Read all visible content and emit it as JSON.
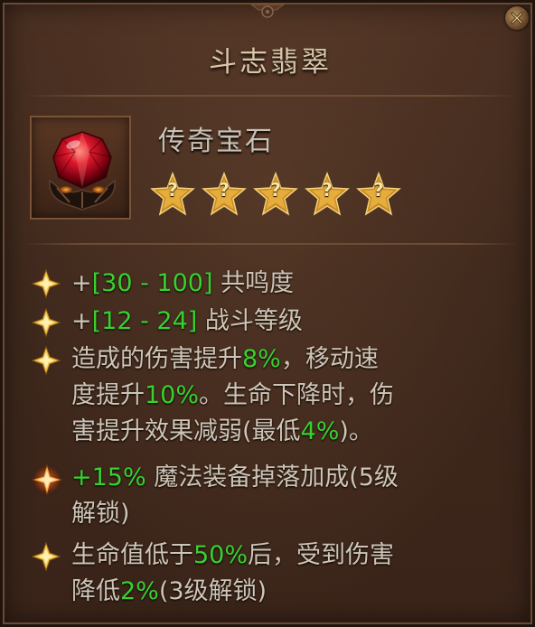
{
  "item": {
    "title": "斗志翡翠",
    "type_label": "传奇宝石",
    "rank_stars": [
      "?",
      "?",
      "?",
      "?",
      "?"
    ]
  },
  "attributes": [
    {
      "plus": "+",
      "value": "[30 - 100]",
      "label": " 共鸣度"
    },
    {
      "plus": "+",
      "value": "[12 - 24]",
      "label": " 战斗等级"
    },
    {
      "line1_a": "造成的伤害提升",
      "line1_v": "8%",
      "line1_b": "，移动速",
      "line2_a": "度提升",
      "line2_v": "10%",
      "line2_b": "。生命下降时，伤",
      "line3_a": "害提升效果减弱(最低",
      "line3_v": "4%",
      "line3_b": ")。"
    },
    {
      "line1_v": "+15%",
      "line1_b": " 魔法装备掉落加成(5级",
      "line2_a": "解锁)"
    },
    {
      "line1_a": "生命值低于",
      "line1_v": "50%",
      "line1_b": "后，受到伤害",
      "line2_a": "降低",
      "line2_v": "2%",
      "line2_b": "(3级解锁)"
    }
  ],
  "colors": {
    "background": "#3e281c",
    "highlight_green": "#38d12f",
    "text": "#cfc5b6",
    "title": "#d9c6a8",
    "star_gold": "#d9a13a",
    "gem_red": "#c8102e"
  },
  "icons": {
    "close": "close-icon",
    "gem": "legendary-gem-icon",
    "star": "star-icon",
    "bullet": "diamond-bullet-icon",
    "bullet_special": "glowing-diamond-bullet-icon"
  }
}
